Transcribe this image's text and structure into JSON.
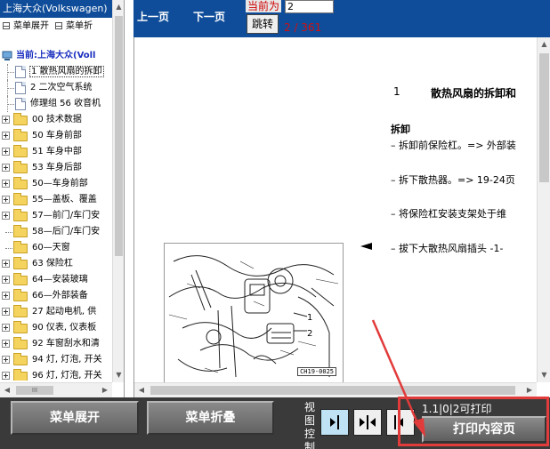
{
  "app": {
    "title": "上海大众(Volkswagen)"
  },
  "left_toolbar": {
    "expand_label": "菜单展开",
    "collapse_label": "菜单折"
  },
  "tree": {
    "current_label": "当前:上海大众(Voll",
    "items": [
      {
        "label": "1 散热风扇的拆卸",
        "kind": "doc",
        "selected": true
      },
      {
        "label": "2 二次空气系统",
        "kind": "doc"
      },
      {
        "label": "修理组 56 收音机",
        "kind": "doc"
      },
      {
        "label": "00 技术数据",
        "kind": "folder"
      },
      {
        "label": "50 车身前部",
        "kind": "folder"
      },
      {
        "label": "51 车身中部",
        "kind": "folder"
      },
      {
        "label": "53 车身后部",
        "kind": "folder"
      },
      {
        "label": "50—车身前部",
        "kind": "folder"
      },
      {
        "label": "55—盖板、覆盖",
        "kind": "folder"
      },
      {
        "label": "57—前门/车门安",
        "kind": "folder"
      },
      {
        "label": "58—后门/车门安",
        "kind": "folder-noplus"
      },
      {
        "label": "60—天窗",
        "kind": "folder-noplus"
      },
      {
        "label": "63 保险杠",
        "kind": "folder"
      },
      {
        "label": "64—安装玻璃",
        "kind": "folder"
      },
      {
        "label": "66—外部装备",
        "kind": "folder"
      },
      {
        "label": "27 起动电机, 供",
        "kind": "folder"
      },
      {
        "label": "90 仪表, 仪表板",
        "kind": "folder"
      },
      {
        "label": "92 车窗刮水和清",
        "kind": "folder"
      },
      {
        "label": "94 灯, 灯泡, 开关",
        "kind": "folder"
      },
      {
        "label": "96 灯, 灯泡, 开关",
        "kind": "folder"
      }
    ],
    "hscroll_label": "III"
  },
  "nav": {
    "prev_label": "上一页",
    "next_label": "下一页",
    "current_label": "当前为",
    "page_value": "2",
    "jump_label": "跳转",
    "page_count": "2 / 361"
  },
  "doc": {
    "heading_num": "1",
    "heading_title": "散热风扇的拆卸和",
    "section": "拆卸",
    "lines": [
      "– 拆卸前保险杠。=> 外部装",
      "– 拆下散热器。=> 19-24页",
      "– 将保险杠安装支架处于维",
      "– 拔下大散热风扇插头 -1-"
    ],
    "figure_tag": "CH19-0025",
    "callouts": [
      "1",
      "2"
    ]
  },
  "bottom": {
    "expand_label": "菜单展开",
    "collapse_label": "菜单折叠",
    "view_label": "视图控制",
    "print_hint": "1.1|0|2可打印",
    "print_label": "打印内容页"
  },
  "colors": {
    "header_blue": "#0f4d9a",
    "highlight_red": "#e23b3b",
    "toolbar_dark": "#3a3a3a"
  }
}
